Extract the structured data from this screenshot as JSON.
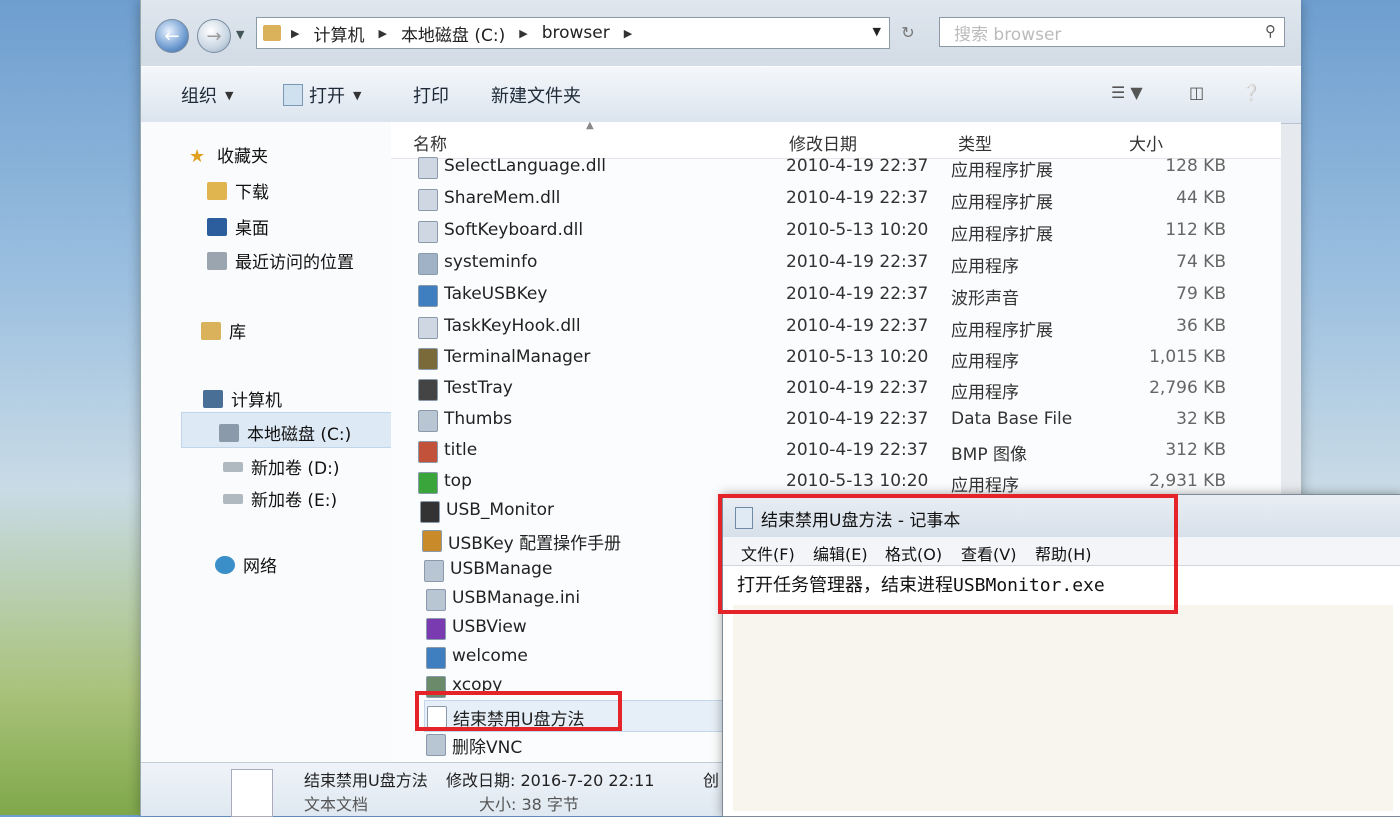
{
  "address": {
    "segments": [
      "计算机",
      "本地磁盘 (C:)",
      "browser"
    ]
  },
  "search": {
    "placeholder": "搜索 browser"
  },
  "toolbar": {
    "organize": "组织",
    "open": "打开",
    "print": "打印",
    "new_folder": "新建文件夹"
  },
  "sidebar": {
    "favorites": "收藏夹",
    "downloads": "下载",
    "desktop": "桌面",
    "recent": "最近访问的位置",
    "libraries": "库",
    "computer": "计算机",
    "drive_c": "本地磁盘 (C:)",
    "drive_d": "新加卷 (D:)",
    "drive_e": "新加卷 (E:)",
    "network": "网络"
  },
  "columns": {
    "name": "名称",
    "date": "修改日期",
    "type": "类型",
    "size": "大小"
  },
  "files": [
    {
      "name": "SelectLanguage.dll",
      "date": "2010-4-19 22:37",
      "type": "应用程序扩展",
      "size": "128 KB"
    },
    {
      "name": "ShareMem.dll",
      "date": "2010-4-19 22:37",
      "type": "应用程序扩展",
      "size": "44 KB"
    },
    {
      "name": "SoftKeyboard.dll",
      "date": "2010-5-13 10:20",
      "type": "应用程序扩展",
      "size": "112 KB"
    },
    {
      "name": "systeminfo",
      "date": "2010-4-19 22:37",
      "type": "应用程序",
      "size": "74 KB"
    },
    {
      "name": "TakeUSBKey",
      "date": "2010-4-19 22:37",
      "type": "波形声音",
      "size": "79 KB"
    },
    {
      "name": "TaskKeyHook.dll",
      "date": "2010-4-19 22:37",
      "type": "应用程序扩展",
      "size": "36 KB"
    },
    {
      "name": "TerminalManager",
      "date": "2010-5-13 10:20",
      "type": "应用程序",
      "size": "1,015 KB"
    },
    {
      "name": "TestTray",
      "date": "2010-4-19 22:37",
      "type": "应用程序",
      "size": "2,796 KB"
    },
    {
      "name": "Thumbs",
      "date": "2010-4-19 22:37",
      "type": "Data Base File",
      "size": "32 KB"
    },
    {
      "name": "title",
      "date": "2010-4-19 22:37",
      "type": "BMP 图像",
      "size": "312 KB"
    },
    {
      "name": "top",
      "date": "2010-5-13 10:20",
      "type": "应用程序",
      "size": "2,931 KB"
    },
    {
      "name": "USB_Monitor",
      "date": "",
      "type": "",
      "size": ""
    },
    {
      "name": "USBKey 配置操作手册",
      "date": "",
      "type": "",
      "size": ""
    },
    {
      "name": "USBManage",
      "date": "",
      "type": "",
      "size": ""
    },
    {
      "name": "USBManage.ini",
      "date": "",
      "type": "",
      "size": ""
    },
    {
      "name": "USBView",
      "date": "",
      "type": "",
      "size": ""
    },
    {
      "name": "welcome",
      "date": "",
      "type": "",
      "size": ""
    },
    {
      "name": "xcopy",
      "date": "",
      "type": "",
      "size": ""
    },
    {
      "name": "结束禁用U盘方法",
      "date": "",
      "type": "",
      "size": ""
    },
    {
      "name": "删除VNC",
      "date": "",
      "type": "",
      "size": ""
    }
  ],
  "details": {
    "name": "结束禁用U盘方法",
    "kind": "文本文档",
    "modified": "修改日期: 2016-7-20 22:11",
    "created": "创",
    "size": "大小: 38 字节"
  },
  "notepad": {
    "title": "结束禁用U盘方法 - 记事本",
    "menu": [
      "文件(F)",
      "编辑(E)",
      "格式(O)",
      "查看(V)",
      "帮助(H)"
    ],
    "text": "打开任务管理器，结束进程USBMonitor.exe"
  },
  "colors": {
    "highlight": "#e5242a",
    "selection": "#dde9f5"
  }
}
